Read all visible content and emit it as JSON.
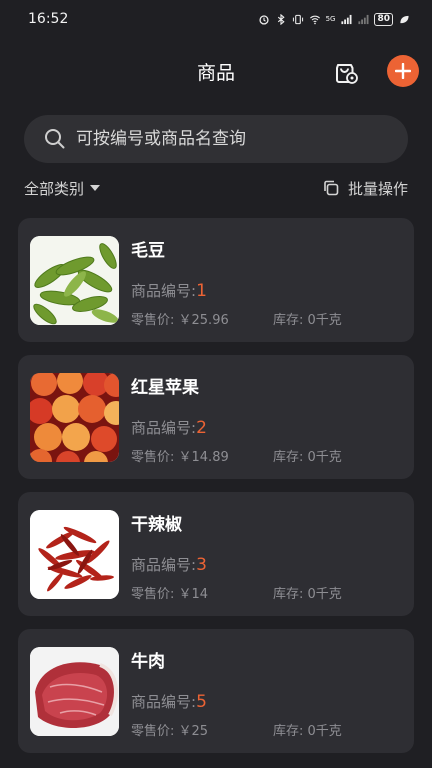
{
  "status": {
    "time": "16:52",
    "network": "5G",
    "battery": "80"
  },
  "header": {
    "title": "商品",
    "scan_icon": "bag-settings-icon",
    "add_icon": "plus-icon",
    "accent": "#ec6334"
  },
  "search": {
    "placeholder": "可按编号或商品名查询"
  },
  "filter": {
    "category_label": "全部类别",
    "batch_label": "批量操作"
  },
  "labels": {
    "code_prefix": "商品编号:",
    "price_prefix": "零售价: ￥",
    "stock_prefix": "库存: "
  },
  "products": [
    {
      "name": "毛豆",
      "code": "1",
      "price": "25.96",
      "stock": "0千克",
      "image": "edamame-image"
    },
    {
      "name": "红星苹果",
      "code": "2",
      "price": "14.89",
      "stock": "0千克",
      "image": "apple-image"
    },
    {
      "name": "干辣椒",
      "code": "3",
      "price": "14",
      "stock": "0千克",
      "image": "chili-image"
    },
    {
      "name": "牛肉",
      "code": "5",
      "price": "25",
      "stock": "0千克",
      "image": "beef-image"
    }
  ]
}
